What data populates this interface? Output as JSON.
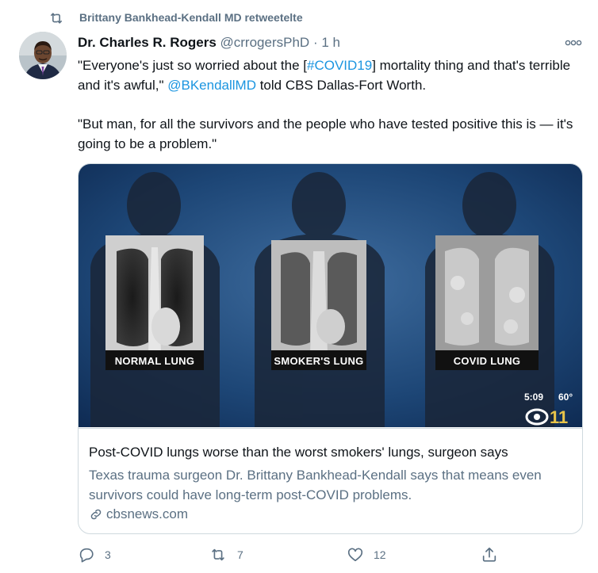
{
  "retweet": {
    "icon": "retweet-icon",
    "text": "Brittany Bankhead-Kendall MD retweetelte"
  },
  "tweet": {
    "author_name": "Dr. Charles R. Rogers",
    "handle": "@crrogersPhD",
    "separator": "·",
    "time": "1 h",
    "text_1a": "\"Everyone's just so worried about the [",
    "hashtag": "#COVID19",
    "text_1b": "] mortality thing and that's terrible and it's awful,\" ",
    "mention": "@BKendallMD",
    "text_1c": " told CBS Dallas-Fort Worth.",
    "text_2": "\"But man, for all the survivors and the people who have tested positive this is — it's going to be a problem.\""
  },
  "card": {
    "image_labels": [
      "NORMAL LUNG",
      "SMOKER'S LUNG",
      "COVID LUNG"
    ],
    "overlay_time": "5:09",
    "overlay_temp": "60°",
    "title": "Post-COVID lungs worse than the worst smokers' lungs, surgeon says",
    "description": "Texas trauma surgeon Dr. Brittany Bankhead-Kendall says that means even survivors could have long-term post-COVID problems.",
    "domain": "cbsnews.com"
  },
  "actions": {
    "reply_count": "3",
    "retweet_count": "7",
    "like_count": "12"
  },
  "colors": {
    "link": "#1b95e0",
    "secondary_text": "#5b7083",
    "border": "#cfd9de"
  }
}
